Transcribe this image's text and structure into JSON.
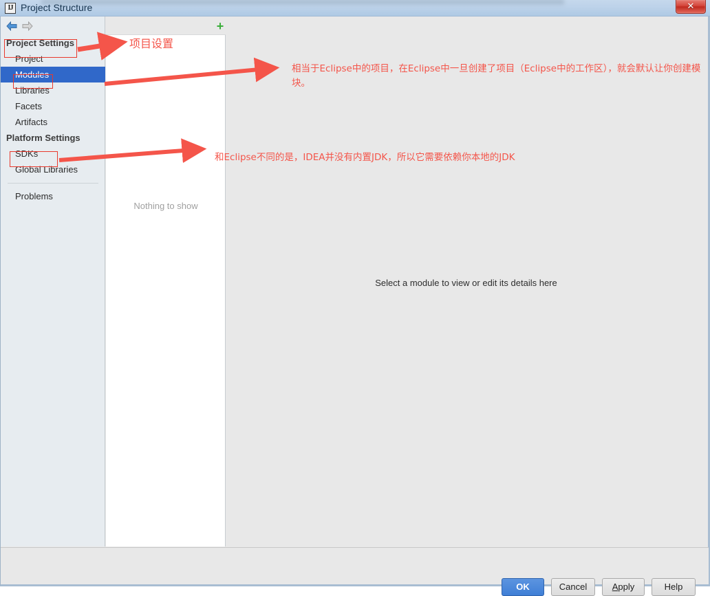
{
  "window": {
    "title": "Project Structure",
    "app_icon": "intellij-idea-icon",
    "icon_text": "IJ",
    "close_label": "✕"
  },
  "nav": {
    "back_icon": "arrow-back-icon",
    "forward_icon": "arrow-forward-icon"
  },
  "sidebar": {
    "groups": [
      {
        "label": "Project Settings",
        "items": [
          {
            "label": "Project",
            "selected": false
          },
          {
            "label": "Modules",
            "selected": true
          },
          {
            "label": "Libraries",
            "selected": false
          },
          {
            "label": "Facets",
            "selected": false
          },
          {
            "label": "Artifacts",
            "selected": false
          }
        ]
      },
      {
        "label": "Platform Settings",
        "items": [
          {
            "label": "SDKs",
            "selected": false
          },
          {
            "label": "Global Libraries",
            "selected": false
          }
        ]
      }
    ],
    "problems_label": "Problems"
  },
  "middle_panel": {
    "toolbar": {
      "add_icon": "plus-icon",
      "add_label": "+",
      "remove_icon": "minus-icon",
      "remove_label": "−",
      "copy_icon": "copy-icon"
    },
    "empty_label": "Nothing to show"
  },
  "detail_panel": {
    "hint": "Select a module to view or edit its details here"
  },
  "footer": {
    "ok": "OK",
    "cancel": "Cancel",
    "apply_mnemonic": "A",
    "apply_rest": "pply",
    "help": "Help"
  },
  "annotations": {
    "accent_color": "#f4554a",
    "box_color": "#e8382c",
    "note_1": "项目设置",
    "note_2": "相当于Eclipse中的项目，在Eclipse中一旦创建了项目（Eclipse中的工作区），就会默认让你创建模块。",
    "note_3": "和Eclipse不同的是，IDEA并没有内置JDK，所以它需要依赖你本地的JDK",
    "boxes": [
      {
        "name": "project-settings-highlight"
      },
      {
        "name": "modules-highlight"
      },
      {
        "name": "sdks-highlight"
      }
    ]
  }
}
